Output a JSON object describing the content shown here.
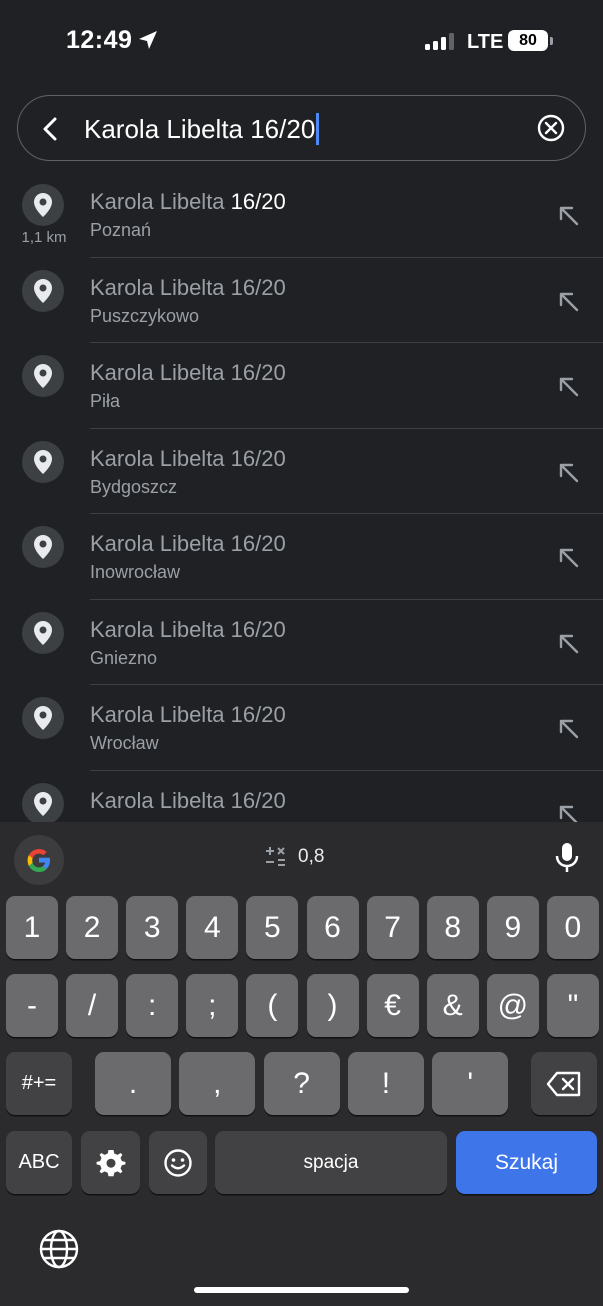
{
  "status_bar": {
    "time": "12:49",
    "network": "LTE",
    "battery": "80"
  },
  "search": {
    "query": "Karola Libelta 16/20"
  },
  "results": [
    {
      "title_prefix": "Karola Libelta ",
      "title_match": "16/20",
      "subtitle": "Poznań",
      "distance": "1,1 km"
    },
    {
      "title_prefix": "Karola Libelta 16/20",
      "title_match": "",
      "subtitle": "Puszczykowo",
      "distance": ""
    },
    {
      "title_prefix": "Karola Libelta 16/20",
      "title_match": "",
      "subtitle": "Piła",
      "distance": ""
    },
    {
      "title_prefix": "Karola Libelta 16/20",
      "title_match": "",
      "subtitle": "Bydgoszcz",
      "distance": ""
    },
    {
      "title_prefix": "Karola Libelta 16/20",
      "title_match": "",
      "subtitle": "Inowrocław",
      "distance": ""
    },
    {
      "title_prefix": "Karola Libelta 16/20",
      "title_match": "",
      "subtitle": "Gniezno",
      "distance": ""
    },
    {
      "title_prefix": "Karola Libelta 16/20",
      "title_match": "",
      "subtitle": "Wrocław",
      "distance": ""
    },
    {
      "title_prefix": "Karola Libelta 16/20",
      "title_match": "",
      "subtitle": "",
      "distance": ""
    }
  ],
  "keyboard": {
    "suggestion": "0,8",
    "row1": [
      "1",
      "2",
      "3",
      "4",
      "5",
      "6",
      "7",
      "8",
      "9",
      "0"
    ],
    "row2": [
      "-",
      "/",
      ":",
      ";",
      "(",
      ")",
      "€",
      "&",
      "@",
      "\""
    ],
    "row3_mode": "#+=",
    "row3": [
      ".",
      ",",
      "?",
      "!",
      "'"
    ],
    "abc": "ABC",
    "space": "spacja",
    "enter": "Szukaj"
  },
  "colors": {
    "background": "#202124",
    "accent": "#3e76ea",
    "caret": "#4c8bf5"
  }
}
